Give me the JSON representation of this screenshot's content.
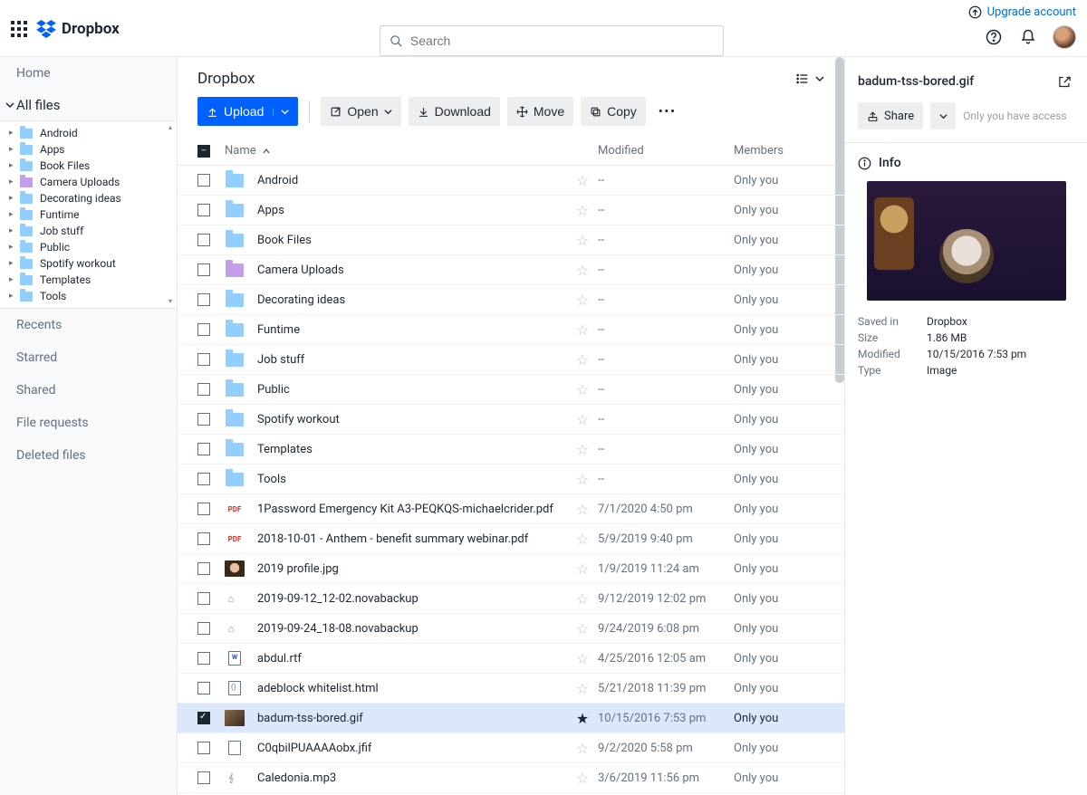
{
  "header": {
    "brand": "Dropbox",
    "upgrade_link": "Upgrade account",
    "search_placeholder": "Search"
  },
  "leftnav": {
    "home": "Home",
    "all_files": "All files",
    "recents": "Recents",
    "starred": "Starred",
    "shared": "Shared",
    "file_requests": "File requests",
    "deleted_files": "Deleted files",
    "tree": [
      {
        "label": "Android",
        "kind": "folder"
      },
      {
        "label": "Apps",
        "kind": "folder"
      },
      {
        "label": "Book Files",
        "kind": "folder"
      },
      {
        "label": "Camera Uploads",
        "kind": "folder-purple"
      },
      {
        "label": "Decorating ideas",
        "kind": "folder"
      },
      {
        "label": "Funtime",
        "kind": "folder"
      },
      {
        "label": "Job stuff",
        "kind": "folder"
      },
      {
        "label": "Public",
        "kind": "folder"
      },
      {
        "label": "Spotify workout",
        "kind": "folder"
      },
      {
        "label": "Templates",
        "kind": "folder"
      },
      {
        "label": "Tools",
        "kind": "folder"
      }
    ]
  },
  "main": {
    "breadcrumb": "Dropbox",
    "toolbar": {
      "upload": "Upload",
      "open": "Open",
      "download": "Download",
      "move": "Move",
      "copy": "Copy"
    },
    "columns": {
      "name": "Name",
      "modified": "Modified",
      "members": "Members"
    },
    "rows": [
      {
        "name": "Android",
        "icon": "folder",
        "modified": "--",
        "members": "Only you",
        "selected": false,
        "starred": false
      },
      {
        "name": "Apps",
        "icon": "folder",
        "modified": "--",
        "members": "Only you",
        "selected": false,
        "starred": false
      },
      {
        "name": "Book Files",
        "icon": "folder",
        "modified": "--",
        "members": "Only you",
        "selected": false,
        "starred": false
      },
      {
        "name": "Camera Uploads",
        "icon": "folder-purple",
        "modified": "--",
        "members": "Only you",
        "selected": false,
        "starred": false
      },
      {
        "name": "Decorating ideas",
        "icon": "folder",
        "modified": "--",
        "members": "Only you",
        "selected": false,
        "starred": false
      },
      {
        "name": "Funtime",
        "icon": "folder",
        "modified": "--",
        "members": "Only you",
        "selected": false,
        "starred": false
      },
      {
        "name": "Job stuff",
        "icon": "folder",
        "modified": "--",
        "members": "Only you",
        "selected": false,
        "starred": false
      },
      {
        "name": "Public",
        "icon": "folder",
        "modified": "--",
        "members": "Only you",
        "selected": false,
        "starred": false
      },
      {
        "name": "Spotify workout",
        "icon": "folder",
        "modified": "--",
        "members": "Only you",
        "selected": false,
        "starred": false
      },
      {
        "name": "Templates",
        "icon": "folder",
        "modified": "--",
        "members": "Only you",
        "selected": false,
        "starred": false
      },
      {
        "name": "Tools",
        "icon": "folder",
        "modified": "--",
        "members": "Only you",
        "selected": false,
        "starred": false
      },
      {
        "name": "1Password Emergency Kit A3-PEQKQS-michaelcrider.pdf",
        "icon": "pdf",
        "modified": "7/1/2020 4:50 pm",
        "members": "Only you",
        "selected": false,
        "starred": false
      },
      {
        "name": "2018-10-01 - Anthem - benefit summary webinar.pdf",
        "icon": "pdf",
        "modified": "5/9/2019 9:40 pm",
        "members": "Only you",
        "selected": false,
        "starred": false
      },
      {
        "name": "2019 profile.jpg",
        "icon": "thumb-face",
        "modified": "1/9/2019 11:24 am",
        "members": "Only you",
        "selected": false,
        "starred": false
      },
      {
        "name": "2019-09-12_12-02.novabackup",
        "icon": "archive",
        "modified": "9/12/2019 12:02 pm",
        "members": "Only you",
        "selected": false,
        "starred": false
      },
      {
        "name": "2019-09-24_18-08.novabackup",
        "icon": "archive",
        "modified": "9/24/2019 6:08 pm",
        "members": "Only you",
        "selected": false,
        "starred": false
      },
      {
        "name": "abdul.rtf",
        "icon": "doc",
        "modified": "4/25/2016 12:05 am",
        "members": "Only you",
        "selected": false,
        "starred": false
      },
      {
        "name": "adeblock whitelist.html",
        "icon": "html",
        "modified": "5/21/2018 11:39 pm",
        "members": "Only you",
        "selected": false,
        "starred": false
      },
      {
        "name": "badum-tss-bored.gif",
        "icon": "thumb",
        "modified": "10/15/2016 7:53 pm",
        "members": "Only you",
        "selected": true,
        "starred": true
      },
      {
        "name": "C0qbilPUAAAAobx.jfif",
        "icon": "image-generic",
        "modified": "9/2/2020 5:58 pm",
        "members": "Only you",
        "selected": false,
        "starred": false
      },
      {
        "name": "Caledonia.mp3",
        "icon": "audio",
        "modified": "3/6/2019 11:56 pm",
        "members": "Only you",
        "selected": false,
        "starred": false
      }
    ]
  },
  "details": {
    "title": "badum-tss-bored.gif",
    "share": "Share",
    "access_text": "Only you have access",
    "info_label": "Info",
    "meta": {
      "saved_in_label": "Saved in",
      "saved_in_value": "Dropbox",
      "size_label": "Size",
      "size_value": "1.86 MB",
      "modified_label": "Modified",
      "modified_value": "10/15/2016 7:53 pm",
      "type_label": "Type",
      "type_value": "Image"
    }
  }
}
